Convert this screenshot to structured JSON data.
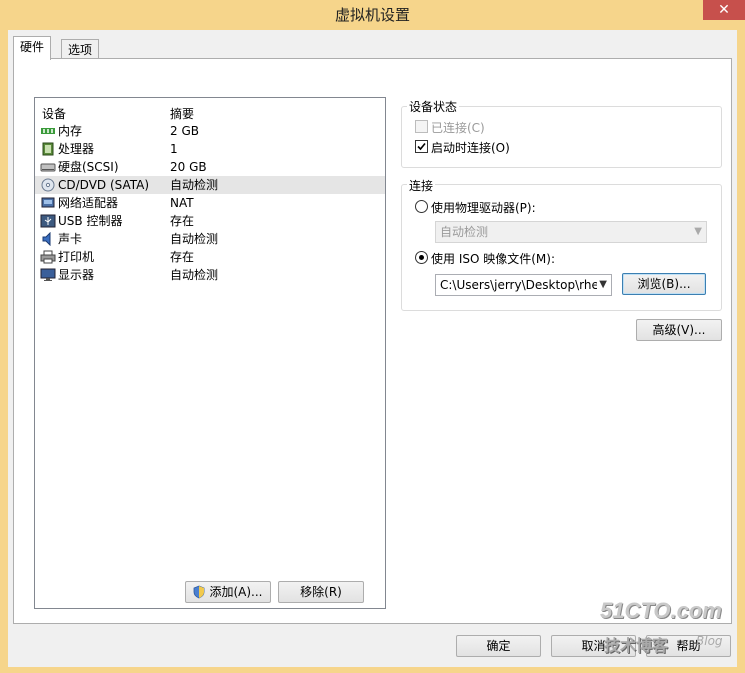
{
  "window": {
    "title": "虚拟机设置",
    "close_label": "✕"
  },
  "tabs": [
    {
      "label": "硬件"
    },
    {
      "label": "选项"
    }
  ],
  "devices": {
    "headers": {
      "device": "设备",
      "summary": "摘要"
    },
    "rows": [
      {
        "name": "内存",
        "summary": "2 GB",
        "icon": "memory-icon"
      },
      {
        "name": "处理器",
        "summary": "1",
        "icon": "cpu-icon"
      },
      {
        "name": "硬盘(SCSI)",
        "summary": "20 GB",
        "icon": "hard-disk-icon"
      },
      {
        "name": "CD/DVD (SATA)",
        "summary": "自动检测",
        "icon": "cd-dvd-icon"
      },
      {
        "name": "网络适配器",
        "summary": "NAT",
        "icon": "network-adapter-icon"
      },
      {
        "name": "USB 控制器",
        "summary": "存在",
        "icon": "usb-icon"
      },
      {
        "name": "声卡",
        "summary": "自动检测",
        "icon": "sound-card-icon"
      },
      {
        "name": "打印机",
        "summary": "存在",
        "icon": "printer-icon"
      },
      {
        "name": "显示器",
        "summary": "自动检测",
        "icon": "display-icon"
      }
    ],
    "selected_index": 3,
    "add_label": "添加(A)...",
    "remove_label": "移除(R)"
  },
  "device_status": {
    "label": "设备状态",
    "connected_label": "已连接(C)",
    "connect_on_power_label": "启动时连接(O)"
  },
  "connection": {
    "label": "连接",
    "physical_drive_label": "使用物理驱动器(P):",
    "physical_drive_value": "自动检测",
    "iso_label": "使用 ISO 映像文件(M):",
    "iso_path": "C:\\Users\\jerry\\Desktop\\rhel-",
    "browse_label": "浏览(B)..."
  },
  "advanced_label": "高级(V)...",
  "footer": {
    "ok_label": "确定",
    "cancel_label": "取消",
    "help_label": "帮助"
  },
  "watermark": {
    "logo": "51CTO.com",
    "sub": "技术博客",
    "blog": "Blog"
  }
}
